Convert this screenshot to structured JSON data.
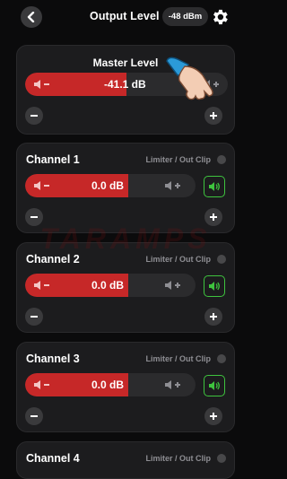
{
  "header": {
    "title": "Output Level",
    "dbm": "-48 dBm"
  },
  "master": {
    "title": "Master Level",
    "value": "-41.1 dB",
    "fill_fraction": 0.5
  },
  "channels": [
    {
      "name": "Channel 1",
      "limiter": "Limiter / Out Clip",
      "value": "0.0 dB"
    },
    {
      "name": "Channel 2",
      "limiter": "Limiter / Out Clip",
      "value": "0.0 dB"
    },
    {
      "name": "Channel 3",
      "limiter": "Limiter / Out Clip",
      "value": "0.0 dB"
    },
    {
      "name": "Channel 4",
      "limiter": "Limiter / Out Clip"
    }
  ],
  "colors": {
    "accent_red": "#c62828",
    "mute_green": "#3ec33e"
  },
  "icons": {
    "back": "chevron-left-icon",
    "settings": "gear-icon",
    "volume_down": "speaker-minus-icon",
    "volume_up": "speaker-plus-icon",
    "unmuted": "speaker-on-icon"
  },
  "watermark": "TARAMPS"
}
